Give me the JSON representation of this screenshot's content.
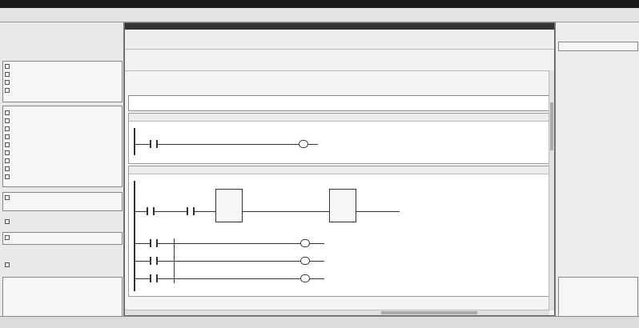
{
  "window": {
    "title": "",
    "status": ""
  },
  "topbar": {
    "labels": [
      "",
      "",
      ""
    ]
  },
  "left_panel": {
    "title": "",
    "tree_items": [
      "",
      "",
      "",
      "",
      "",
      "",
      "",
      "",
      "",
      "",
      "",
      "",
      "",
      "",
      "",
      "",
      ""
    ],
    "details_title": ""
  },
  "editor": {
    "tabs": [
      "",
      "",
      ""
    ],
    "block_title": "",
    "block_interface": "",
    "comment": "",
    "networks": [
      {
        "title": "",
        "contact_label": "",
        "coil_label": ""
      },
      {
        "title": "",
        "input1": "",
        "input2": "",
        "block1": "",
        "block1_out": "",
        "block2": "",
        "block2_out": "",
        "branch_coils": [
          "",
          "",
          ""
        ]
      }
    ]
  },
  "right_panel": {
    "title": "",
    "items": [
      "",
      "",
      "",
      "",
      "",
      "",
      ""
    ]
  },
  "bottom": {
    "items": [
      "",
      "",
      "",
      ""
    ]
  }
}
